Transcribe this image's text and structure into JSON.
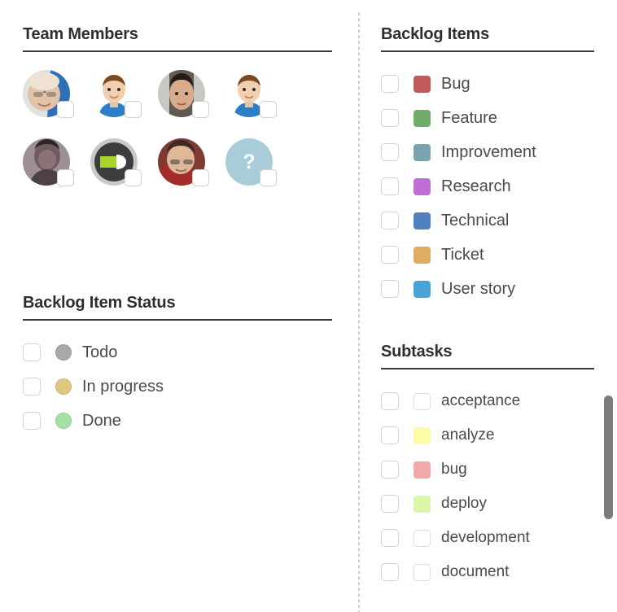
{
  "panels": {
    "team_members": {
      "title": "Team Members",
      "members": [
        {
          "name": "member-1",
          "type": "photo",
          "alt": "bald man with glasses photo"
        },
        {
          "name": "member-2",
          "type": "cartoon",
          "alt": "cartoon avatar blue shirt"
        },
        {
          "name": "member-3",
          "type": "photo",
          "alt": "man dark hair photo"
        },
        {
          "name": "member-4",
          "type": "cartoon",
          "alt": "cartoon avatar blue shirt"
        },
        {
          "name": "member-5",
          "type": "photo",
          "alt": "sepia photo man"
        },
        {
          "name": "member-6",
          "type": "logo",
          "alt": "green logo mark"
        },
        {
          "name": "member-7",
          "type": "photo",
          "alt": "man with glasses red jacket photo"
        },
        {
          "name": "member-8",
          "type": "unknown",
          "alt": "unknown user",
          "glyph": "?"
        }
      ]
    },
    "backlog_item_status": {
      "title": "Backlog Item Status",
      "items": [
        {
          "label": "Todo",
          "color": "#a8a8a8"
        },
        {
          "label": "In progress",
          "color": "#ddc87e"
        },
        {
          "label": "Done",
          "color": "#a5e0a5"
        }
      ]
    },
    "backlog_items": {
      "title": "Backlog Items",
      "items": [
        {
          "label": "Bug",
          "color": "#c15b5b"
        },
        {
          "label": "Feature",
          "color": "#71ad6a"
        },
        {
          "label": "Improvement",
          "color": "#7ba3ae"
        },
        {
          "label": "Research",
          "color": "#c16fd4"
        },
        {
          "label": "Technical",
          "color": "#5080bd"
        },
        {
          "label": "Ticket",
          "color": "#e0ab64"
        },
        {
          "label": "User story",
          "color": "#4aa3d8"
        }
      ]
    },
    "subtasks": {
      "title": "Subtasks",
      "items": [
        {
          "label": "acceptance",
          "color": ""
        },
        {
          "label": "analyze",
          "color": "#fbfba8"
        },
        {
          "label": "bug",
          "color": "#f1a8a8"
        },
        {
          "label": "deploy",
          "color": "#dcf7a8"
        },
        {
          "label": "development",
          "color": ""
        },
        {
          "label": "document",
          "color": ""
        }
      ]
    }
  }
}
